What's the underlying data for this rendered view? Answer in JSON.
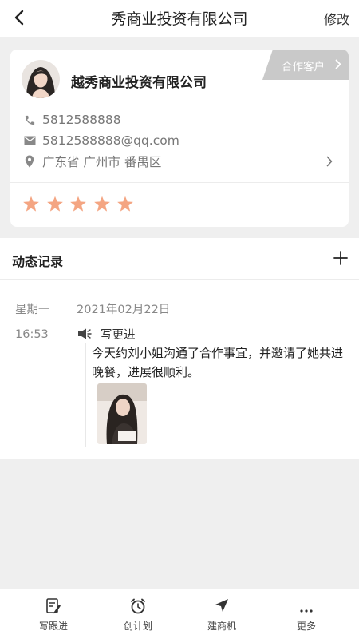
{
  "header": {
    "title": "秀商业投资有限公司",
    "edit_label": "修改"
  },
  "customer": {
    "company_name": "越秀商业投资有限公司",
    "tag_label": "合作客户",
    "phone": "5812588888",
    "email": "5812588888@qq.com",
    "address": "广东省 广州市 番禺区",
    "rating": 5,
    "rating_max": 5,
    "star_color": "#f4a582"
  },
  "timeline": {
    "section_title": "动态记录",
    "entry": {
      "weekday": "星期一",
      "date": "2021年02月22日",
      "time": "16:53",
      "type_label": "写更进",
      "content": "今天约刘小姐沟通了合作事宜，并邀请了她共进晚餐，进展很顺利。"
    }
  },
  "bottom_nav": {
    "items": [
      {
        "label": "写跟进",
        "icon": "write-follow-icon"
      },
      {
        "label": "创计划",
        "icon": "alarm-clock-icon"
      },
      {
        "label": "建商机",
        "icon": "paper-plane-icon"
      },
      {
        "label": "更多",
        "icon": "more-dots-icon"
      }
    ]
  }
}
